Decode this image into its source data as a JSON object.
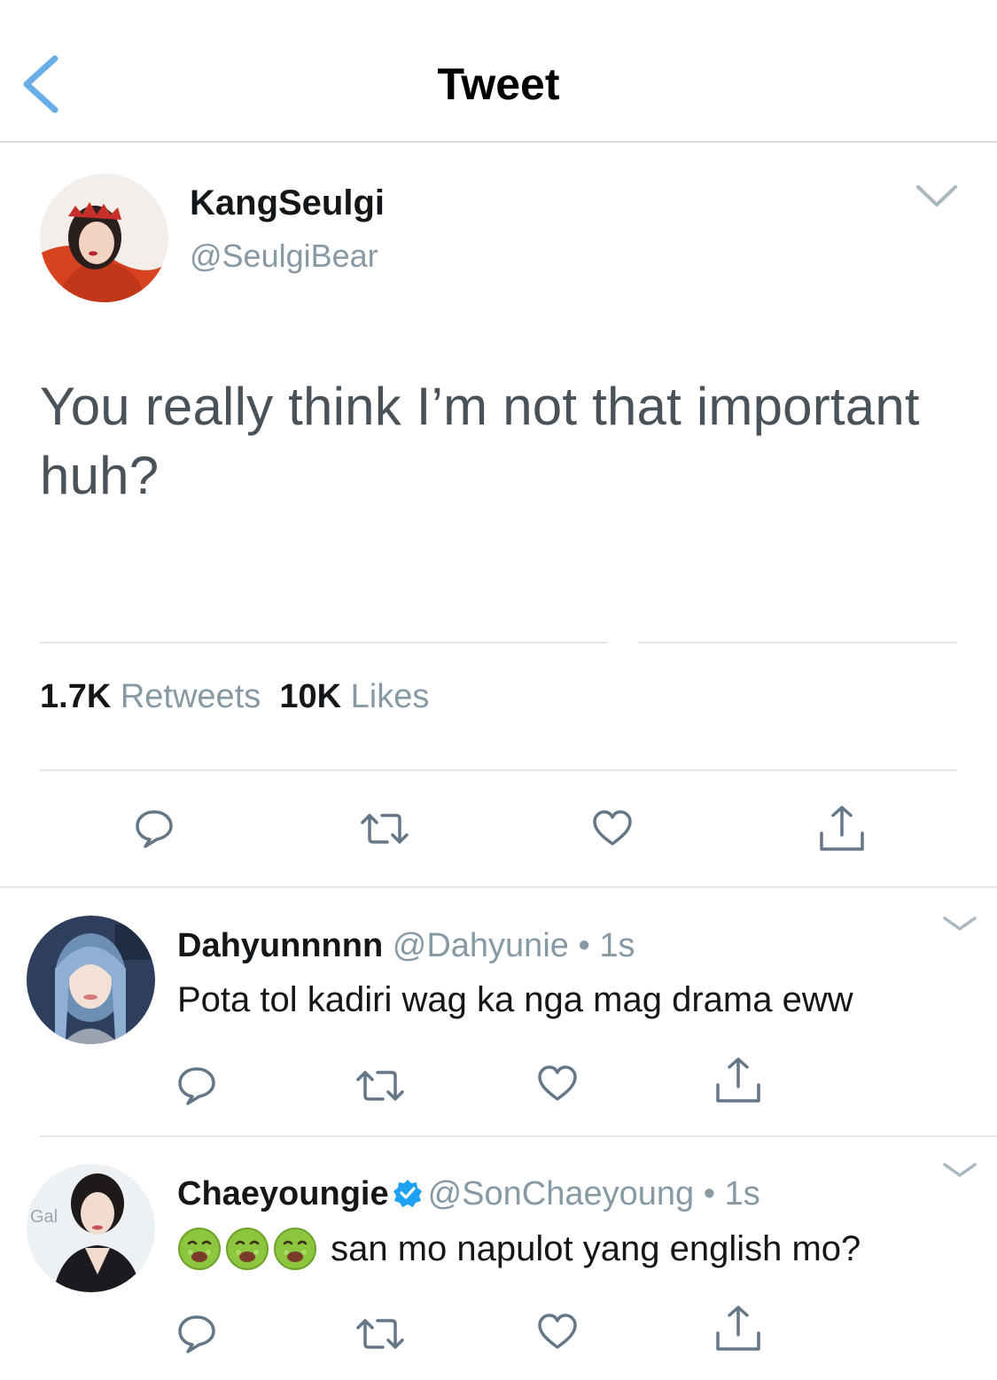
{
  "nav": {
    "title": "Tweet"
  },
  "main_tweet": {
    "name": "KangSeulgi",
    "handle": "@SeulgiBear",
    "text": "You really think I’m not that important huh?",
    "retweets_count": "1.7K",
    "retweets_label": "Retweets",
    "likes_count": "10K",
    "likes_label": "Likes"
  },
  "replies": [
    {
      "name": "Dahyunnnnn",
      "handle": "@Dahyunie",
      "separator": "•",
      "time": "1s",
      "text": "Pota tol kadiri wag ka nga mag drama eww",
      "verified": false
    },
    {
      "name": "Chaeyoungie",
      "handle": "@SonChaeyoung",
      "separator": "•",
      "time": "1s",
      "text": "san mo napulot yang english mo?",
      "verified": true,
      "emojis": [
        "nauseated-face",
        "nauseated-face",
        "nauseated-face"
      ],
      "avatar_text": "Gal"
    }
  ],
  "colors": {
    "accent": "#1da1f2",
    "back_arrow": "#6aaee8",
    "muted": "#8899a6",
    "icon": "#657786",
    "divider": "#e1e6ea"
  }
}
